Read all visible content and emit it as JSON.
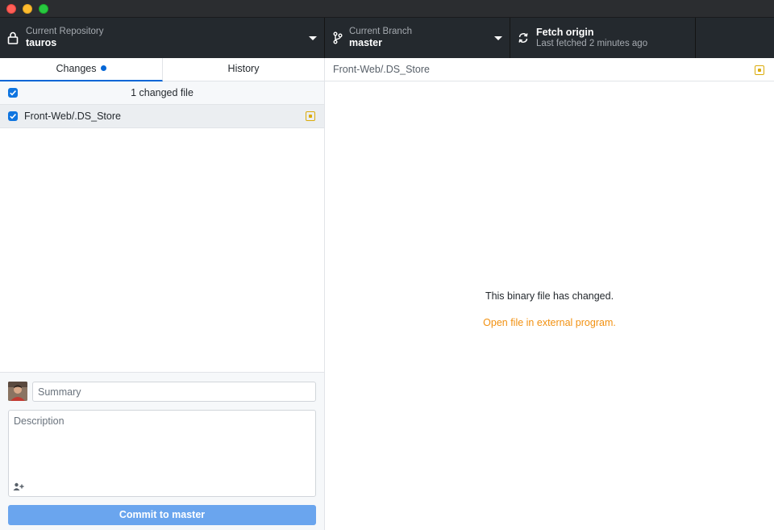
{
  "window": {
    "controls": [
      "close",
      "minimize",
      "maximize"
    ]
  },
  "toolbar": {
    "repository": {
      "description": "Current Repository",
      "title": "tauros",
      "icon": "lock-icon"
    },
    "branch": {
      "description": "Current Branch",
      "title": "master",
      "icon": "git-branch-icon"
    },
    "fetch": {
      "title": "Fetch origin",
      "description": "Last fetched 2 minutes ago",
      "icon": "sync-icon"
    }
  },
  "tabs": {
    "changes": "Changes",
    "history": "History"
  },
  "changes": {
    "header": "1 changed file",
    "files": [
      {
        "path": "Front-Web/.DS_Store",
        "checked": true,
        "status": "modified"
      }
    ]
  },
  "commit": {
    "summary_placeholder": "Summary",
    "description_placeholder": "Description",
    "button_prefix": "Commit to ",
    "button_branch": "master"
  },
  "diff": {
    "path": "Front-Web/.DS_Store",
    "message": "This binary file has changed.",
    "link": "Open file in external program."
  },
  "colors": {
    "toolbar_bg": "#24292e",
    "accent_blue": "#0366d6",
    "modified_yellow": "#dbab09",
    "link_orange": "#f29111",
    "commit_button": "#6aa5ee"
  }
}
